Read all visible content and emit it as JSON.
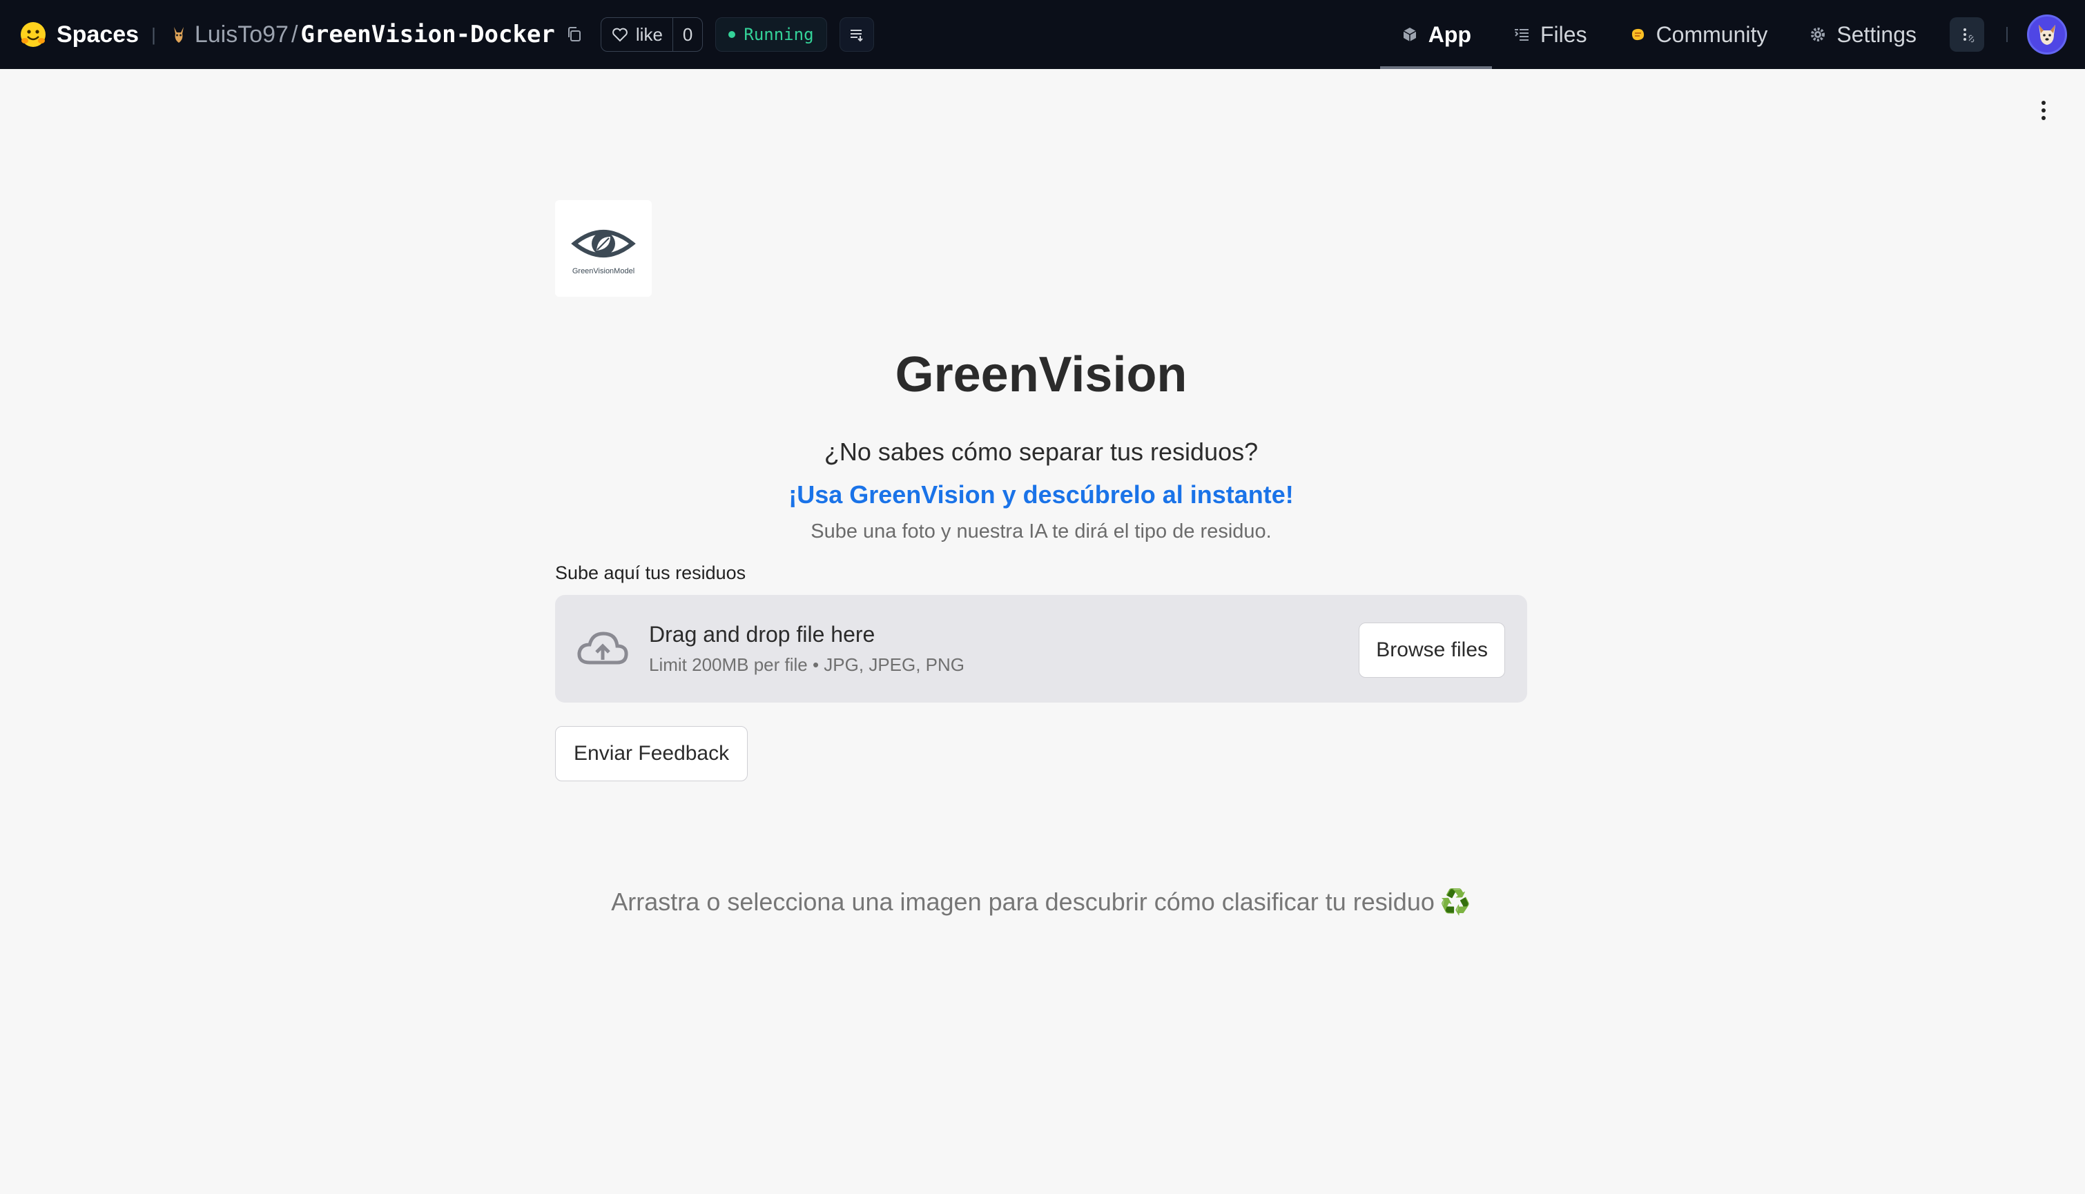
{
  "topbar": {
    "spaces_label": "Spaces",
    "owner": "LuisTo97",
    "separator": "/",
    "repo": "GreenVision-Docker",
    "like_label": "like",
    "like_count": "0",
    "status": "Running",
    "nav": [
      {
        "label": "App",
        "icon": "cube-icon",
        "active": true
      },
      {
        "label": "Files",
        "icon": "files-icon",
        "active": false
      },
      {
        "label": "Community",
        "icon": "community-icon",
        "active": false
      },
      {
        "label": "Settings",
        "icon": "gear-icon",
        "active": false
      }
    ]
  },
  "app": {
    "logo_text": "GreenVisionModel",
    "title": "GreenVision",
    "question": "¿No sabes cómo separar tus residuos?",
    "cta": "¡Usa GreenVision y descúbrelo al instante!",
    "note": "Sube una foto y nuestra IA te dirá el tipo de residuo.",
    "upload_label": "Sube aquí tus residuos",
    "dropzone_title": "Drag and drop file here",
    "dropzone_limit": "Limit 200MB per file • JPG, JPEG, PNG",
    "browse_label": "Browse files",
    "feedback_label": "Enviar Feedback",
    "hint": "Arrastra o selecciona una imagen para descubrir cómo clasificar tu residuo",
    "hint_emoji": "♻️"
  },
  "colors": {
    "topbar_bg": "#0b0f19",
    "page_bg": "#f7f7f7",
    "link_blue": "#1a73e8",
    "status_green": "#34d399"
  }
}
